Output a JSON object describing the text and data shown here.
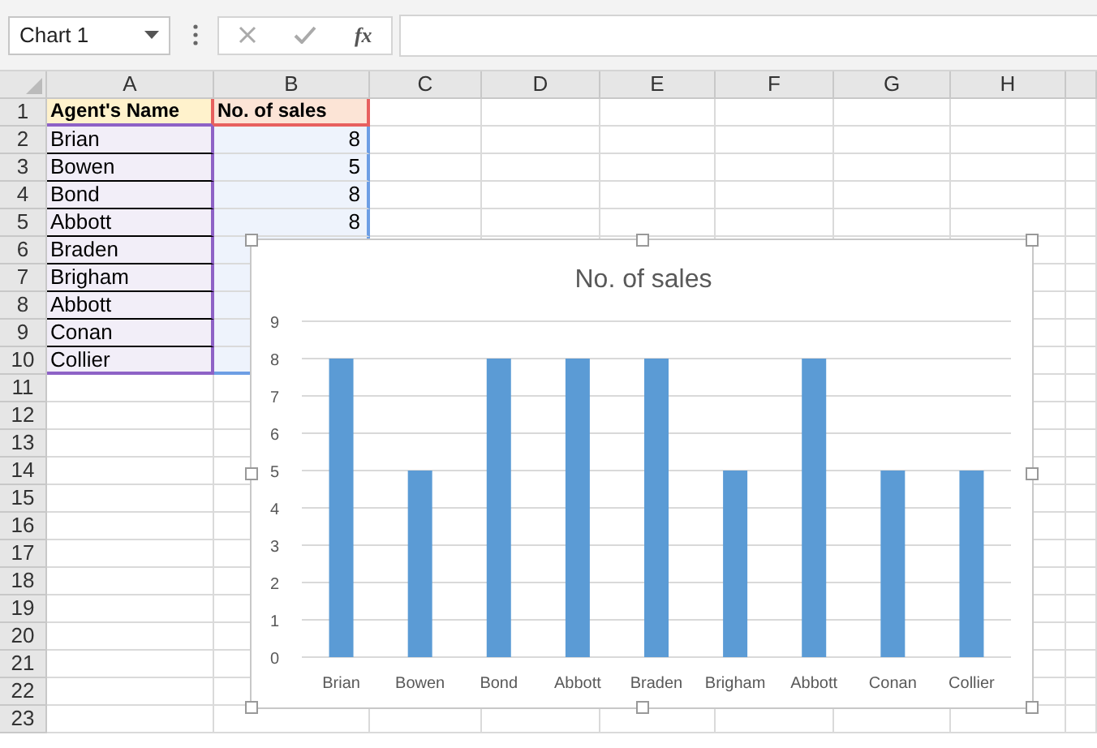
{
  "name_box": {
    "value": "Chart 1"
  },
  "formula_bar": {
    "function_label": "fx"
  },
  "columns": [
    "A",
    "B",
    "C",
    "D",
    "E",
    "F",
    "G",
    "H"
  ],
  "rows": [
    {
      "number": "1",
      "kind": "header",
      "cells": [
        "Agent's Name",
        "No. of sales"
      ]
    },
    {
      "number": "2",
      "kind": "data",
      "cells": [
        "Brian",
        "8"
      ]
    },
    {
      "number": "3",
      "kind": "data",
      "cells": [
        "Bowen",
        "5"
      ]
    },
    {
      "number": "4",
      "kind": "data",
      "cells": [
        "Bond",
        "8"
      ]
    },
    {
      "number": "5",
      "kind": "data",
      "cells": [
        "Abbott",
        "8"
      ]
    },
    {
      "number": "6",
      "kind": "data",
      "cells": [
        "Braden"
      ]
    },
    {
      "number": "7",
      "kind": "data",
      "cells": [
        "Brigham"
      ]
    },
    {
      "number": "8",
      "kind": "data",
      "cells": [
        "Abbott"
      ]
    },
    {
      "number": "9",
      "kind": "data",
      "cells": [
        "Conan"
      ]
    },
    {
      "number": "10",
      "kind": "data",
      "cells": [
        "Collier"
      ]
    },
    {
      "number": "11",
      "kind": "empty"
    },
    {
      "number": "12",
      "kind": "empty"
    },
    {
      "number": "13",
      "kind": "empty"
    },
    {
      "number": "14",
      "kind": "empty"
    },
    {
      "number": "15",
      "kind": "empty"
    },
    {
      "number": "16",
      "kind": "empty"
    },
    {
      "number": "17",
      "kind": "empty"
    },
    {
      "number": "18",
      "kind": "empty"
    },
    {
      "number": "19",
      "kind": "empty"
    },
    {
      "number": "20",
      "kind": "empty"
    },
    {
      "number": "21",
      "kind": "empty"
    },
    {
      "number": "22",
      "kind": "empty"
    },
    {
      "number": "23",
      "kind": "empty"
    }
  ],
  "chart": {
    "chart_data": {
      "type": "bar",
      "title": "No. of sales",
      "categories": [
        "Brian",
        "Bowen",
        "Bond",
        "Abbott",
        "Braden",
        "Brigham",
        "Abbott",
        "Conan",
        "Collier"
      ],
      "series": [
        {
          "color": "#5b9bd5",
          "values": [
            8,
            5,
            8,
            8,
            8,
            5,
            8,
            5,
            5
          ]
        }
      ],
      "grid": true,
      "ylim": [
        0,
        9
      ],
      "yticks": [
        0,
        1,
        2,
        3,
        4,
        5,
        6,
        7,
        8,
        9
      ]
    }
  }
}
